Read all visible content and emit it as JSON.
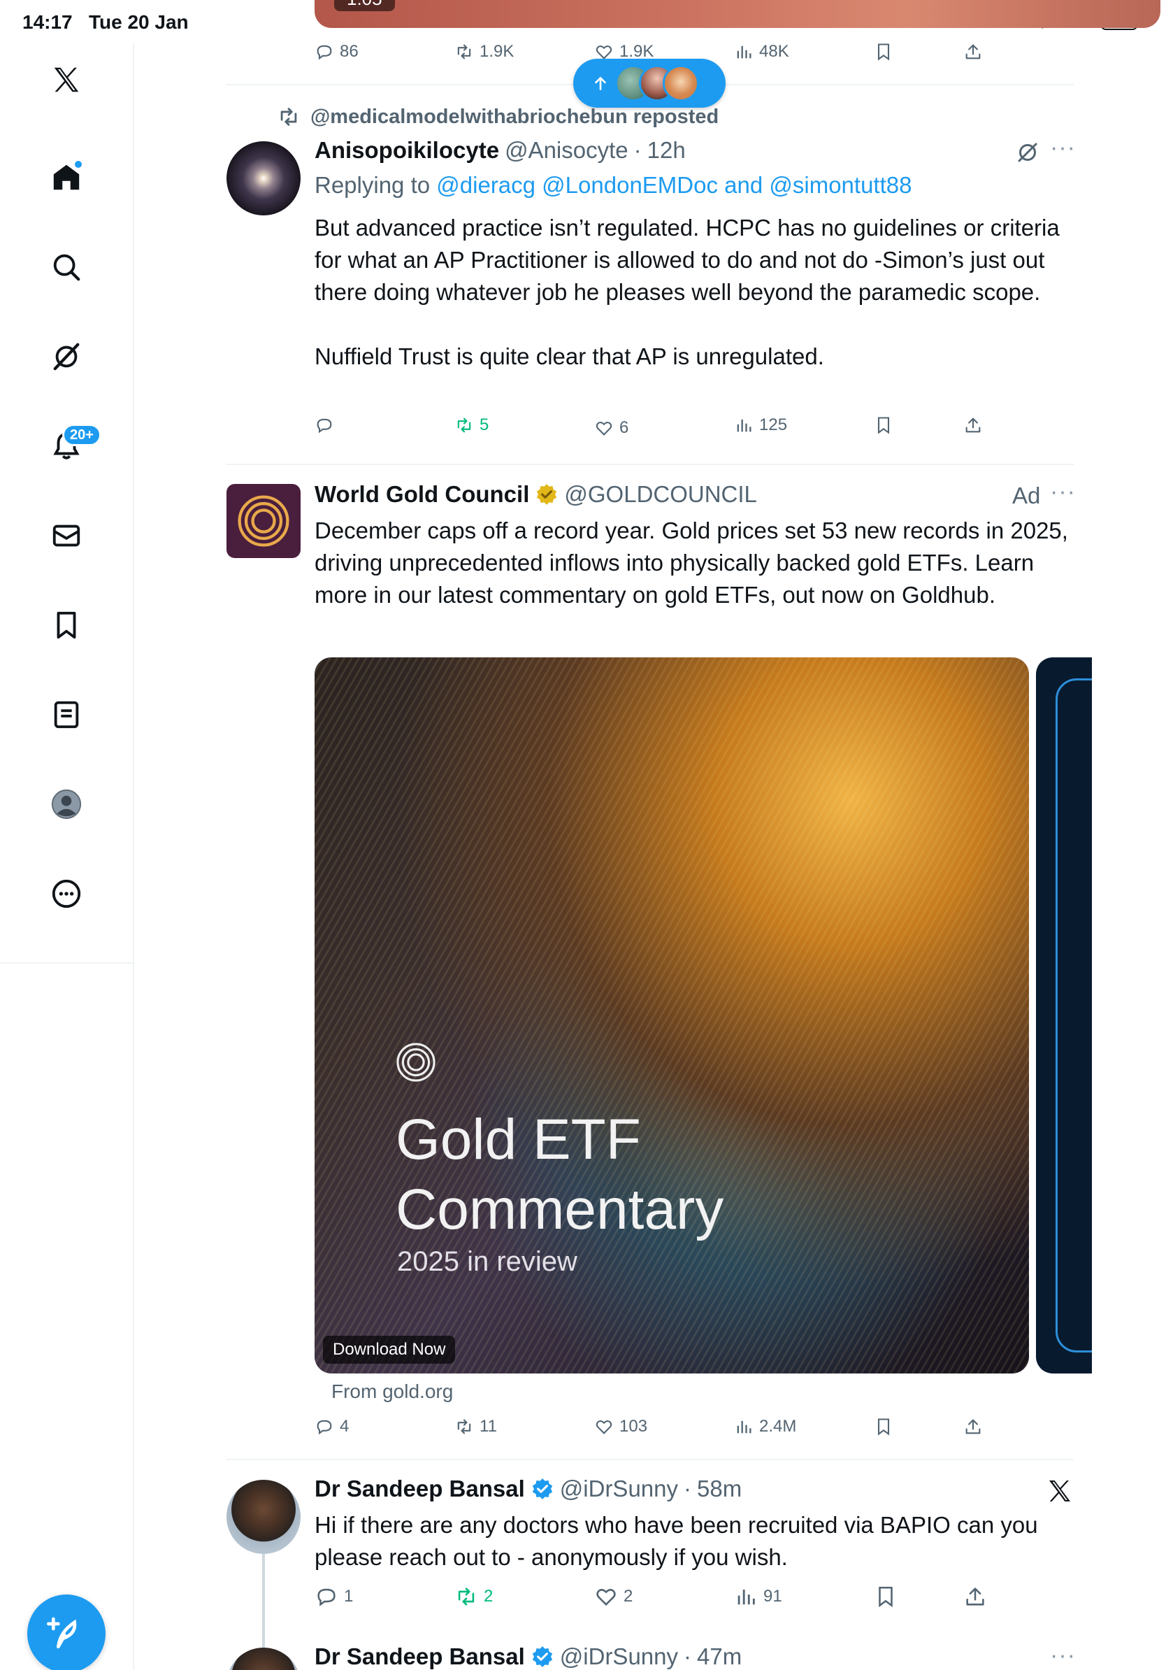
{
  "status_bar": {
    "time": "14:17",
    "date": "Tue 20 Jan",
    "battery": "80%",
    "battery_level": 0.8
  },
  "sidebar": {
    "items": [
      {
        "name": "x-logo-icon"
      },
      {
        "name": "home-icon",
        "has_dot": true
      },
      {
        "name": "search-icon"
      },
      {
        "name": "grok-icon"
      },
      {
        "name": "notifications-icon",
        "badge": "20+"
      },
      {
        "name": "messages-icon"
      },
      {
        "name": "bookmarks-icon"
      },
      {
        "name": "lists-icon"
      },
      {
        "name": "profile-icon"
      },
      {
        "name": "more-icon"
      }
    ],
    "compose_button": "compose-post-icon"
  },
  "colors": {
    "accent": "#1d9bf0",
    "repost_green": "#00ba7c",
    "muted": "#536471",
    "gold_badge": "#e2b719"
  },
  "previous_tweet": {
    "media_tag": "1:05",
    "actions": {
      "replies": "86",
      "reposts": "1.9K",
      "likes": "1.9K",
      "views": "48K"
    }
  },
  "new_posts_pill": {
    "icon": "arrow-up-icon"
  },
  "tweet1": {
    "reposted_by": "@medicalmodelwithabriochebun reposted",
    "name": "Anisopoikilocyte",
    "handle": "@Anisocyte",
    "time": "12h",
    "replying_prefix": "Replying to",
    "replying_to": "@dieracg @LondonEMDoc and @simontutt88",
    "text_p1": "But advanced practice isn’t regulated. HCPC has no guidelines or criteria for what an AP Practitioner is allowed to do and not do -Simon’s just out there doing whatever job he pleases well beyond the paramedic scope.",
    "text_p2": "Nuffield Trust is quite clear that AP is unregulated.",
    "actions": {
      "replies": "",
      "reposts": "5",
      "likes": "6",
      "views": "125"
    }
  },
  "tweet2": {
    "name": "World Gold Council",
    "handle": "@GOLDCOUNCIL",
    "ad_label": "Ad",
    "text": "December caps off a record year. Gold prices set 53 new records in 2025, driving unprecedented inflows into physically backed gold ETFs. Learn more in our latest commentary on gold ETFs, out now on Goldhub.",
    "card": {
      "title_line1": "Gold ETF",
      "title_line2": "Commentary",
      "subtitle": "2025 in review",
      "cta": "Download Now"
    },
    "source": "From gold.org",
    "actions": {
      "replies": "4",
      "reposts": "11",
      "likes": "103",
      "views": "2.4M"
    }
  },
  "tweet3": {
    "name": "Dr Sandeep Bansal",
    "handle": "@iDrSunny",
    "time": "58m",
    "text": "Hi if there are any doctors who have been recruited via BAPIO can you please reach out to - anonymously if you wish.",
    "actions": {
      "replies": "1",
      "reposts": "2",
      "likes": "2",
      "views": "91"
    }
  },
  "tweet4": {
    "name": "Dr Sandeep Bansal",
    "handle": "@iDrSunny",
    "time": "47m"
  }
}
